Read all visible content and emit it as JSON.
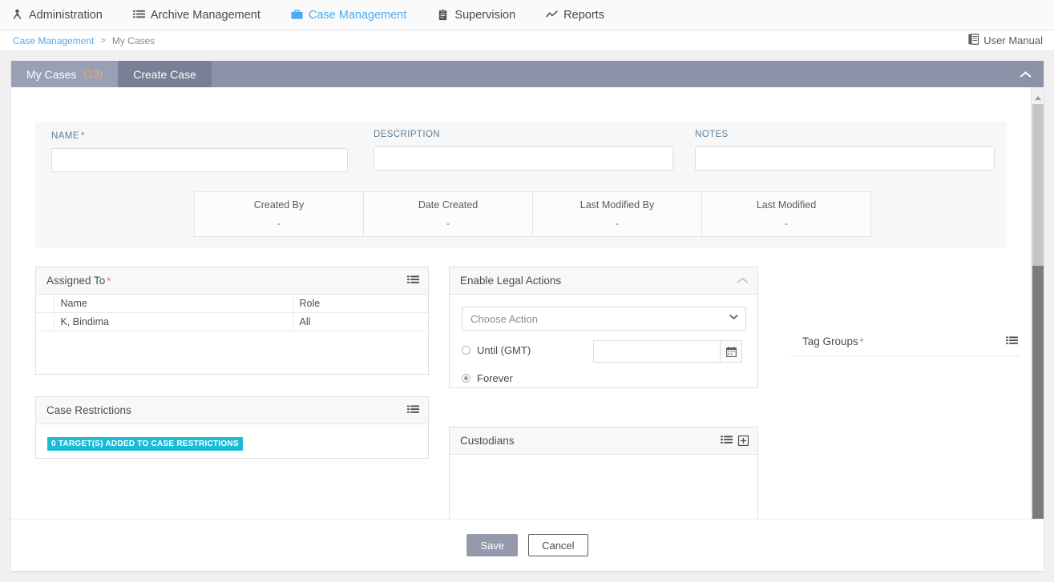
{
  "nav": {
    "items": [
      {
        "label": "Administration",
        "icon": "people-icon",
        "active": false
      },
      {
        "label": "Archive Management",
        "icon": "list-icon",
        "active": false
      },
      {
        "label": "Case Management",
        "icon": "briefcase-icon",
        "active": true
      },
      {
        "label": "Supervision",
        "icon": "clipboard-icon",
        "active": false
      },
      {
        "label": "Reports",
        "icon": "line-chart-icon",
        "active": false
      }
    ]
  },
  "breadcrumb": {
    "root": "Case Management",
    "separator": ">",
    "current": "My Cases"
  },
  "user_manual": {
    "label": "User Manual",
    "icon": "book-icon"
  },
  "tabs": {
    "my_cases": {
      "label": "My Cases",
      "count": "(13)"
    },
    "create_case": {
      "label": "Create Case"
    },
    "collapse_icon": "chevron-up-icon"
  },
  "form": {
    "name": {
      "label": "NAME",
      "required": true,
      "value": "",
      "placeholder": ""
    },
    "description": {
      "label": "DESCRIPTION",
      "required": false,
      "value": "",
      "placeholder": ""
    },
    "notes": {
      "label": "NOTES",
      "required": false,
      "value": "",
      "placeholder": ""
    }
  },
  "metadata": {
    "columns": [
      "Created By",
      "Date Created",
      "Last Modified By",
      "Last Modified"
    ],
    "values": [
      "-",
      "-",
      "-",
      "-"
    ]
  },
  "assigned_to": {
    "title": "Assigned To",
    "required": true,
    "tool_icon": "list-icon",
    "columns": [
      "Name",
      "Role"
    ],
    "rows": [
      {
        "name": "K, Bindima",
        "role": "All"
      }
    ]
  },
  "case_restrictions": {
    "title": "Case Restrictions",
    "tool_icon": "list-icon",
    "badge": "0 TARGET(S) ADDED TO CASE RESTRICTIONS",
    "badge_color": "#1bbbd6"
  },
  "legal_actions": {
    "title": "Enable Legal Actions",
    "collapse_icon": "chevron-up-icon",
    "action_select": {
      "selected": "Choose Action",
      "options": [
        "Choose Action"
      ]
    },
    "until": {
      "label": "Until (GMT)",
      "selected": false,
      "value": "",
      "calendar_icon": "calendar-icon"
    },
    "forever": {
      "label": "Forever",
      "selected": true
    }
  },
  "custodians": {
    "title": "Custodians",
    "tool_icons": [
      "list-icon",
      "plus-box-icon"
    ]
  },
  "tag_groups": {
    "title": "Tag Groups",
    "required": true,
    "tool_icon": "list-icon"
  },
  "footer": {
    "save_label": "Save",
    "cancel_label": "Cancel"
  },
  "scrollbar": {
    "up_icon": "triangle-up-icon",
    "down_icon": "triangle-down-icon"
  }
}
